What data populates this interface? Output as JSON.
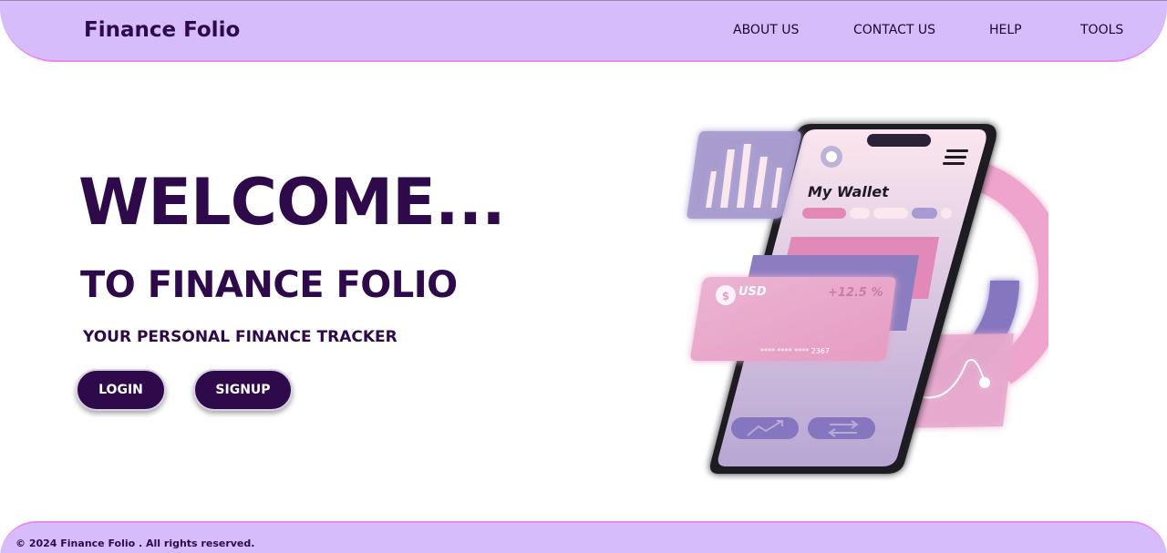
{
  "header": {
    "brand": "Finance Folio",
    "nav": [
      "ABOUT US",
      "CONTACT US",
      "HELP",
      "TOOLS"
    ]
  },
  "hero": {
    "heading": "WELCOME...",
    "subheading": "TO FINANCE FOLIO",
    "tagline": "YOUR PERSONAL FINANCE TRACKER",
    "login_label": "LOGIN",
    "signup_label": "SIGNUP"
  },
  "illustration": {
    "wallet_title": "My Wallet",
    "currency": "USD",
    "change": "+12.5 %",
    "card_number": "**** **** **** 2367",
    "icons": [
      "bar-chart-icon",
      "dollar-coin-icon",
      "menu-icon",
      "trend-up-icon",
      "transfer-icon"
    ]
  },
  "footer": {
    "copyright": "© 2024 Finance Folio . All rights reserved."
  },
  "colors": {
    "primary": "#2e0a4a",
    "header_bg": "#d7bcfc",
    "accent_border": "#ee88ee"
  }
}
